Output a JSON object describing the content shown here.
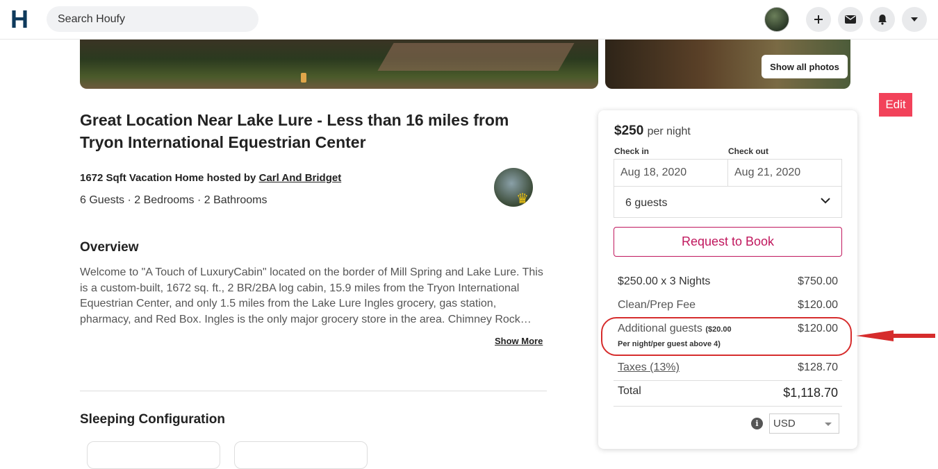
{
  "nav": {
    "logo": "H",
    "search_placeholder": "Search Houfy",
    "icons": [
      "plus-icon",
      "mail-icon",
      "bell-icon",
      "chevron-down-icon"
    ]
  },
  "gallery": {
    "show_all_photos": "Show all photos"
  },
  "edit_label": "Edit",
  "listing": {
    "title": "Great Location Near Lake Lure - Less than 16 miles from Tryon International Equestrian Center",
    "host_prefix": "1672 Sqft Vacation Home hosted by ",
    "host_name": "Carl And Bridget",
    "stats": "6 Guests · 2 Bedrooms · 2 Bathrooms",
    "overview_heading": "Overview",
    "overview_text": "Welcome to \"A Touch of LuxuryCabin\" located on the border of Mill Spring and Lake Lure. This is a custom-built, 1672 sq. ft., 2 BR/2BA log cabin, 15.9 miles from the Tryon International Equestrian Center, and only 1.5 miles from the Lake Lure Ingles grocery, gas station, pharmacy, and Red Box. Ingles is the only major grocery store in the area. Chimney Rock…",
    "show_more": "Show More",
    "sleeping_heading": "Sleeping Configuration"
  },
  "booking": {
    "price": "$250",
    "price_unit": "per night",
    "check_in_label": "Check in",
    "check_out_label": "Check out",
    "check_in": "Aug 18, 2020",
    "check_out": "Aug 21, 2020",
    "guests": "6 guests",
    "request_button": "Request to Book",
    "nights_label": "$250.00 x 3 Nights",
    "nights_value": "$750.00",
    "fee_label": "Clean/Prep Fee",
    "fee_value": "$120.00",
    "additional_label": "Additional guests",
    "additional_note_a": "($20.00",
    "additional_note_b": "Per night/per guest above 4)",
    "additional_value": "$120.00",
    "taxes_label": "Taxes (13%)",
    "taxes_value": "$128.70",
    "total_label": "Total",
    "total_value": "$1,118.70",
    "currency": "USD"
  },
  "colors": {
    "brand": "#0e3a5c",
    "request": "#c0175d",
    "edit": "#f2425a",
    "annotation": "#d62c2c"
  }
}
